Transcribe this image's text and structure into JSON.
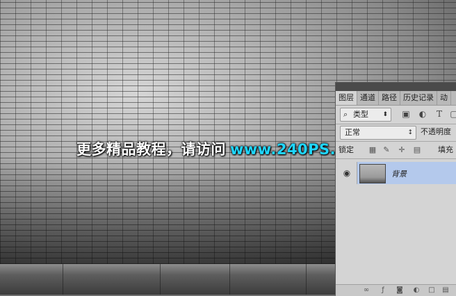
{
  "watermark": {
    "text_cn": "更多精品教程，请访问",
    "text_url": "www.240PS.com"
  },
  "colors": {
    "accent_url": "#1fd6ff",
    "selected_layer": "#b4c9ec"
  },
  "layers_panel": {
    "tabs": [
      {
        "label": "图层",
        "active": true
      },
      {
        "label": "通道",
        "active": false
      },
      {
        "label": "路径",
        "active": false
      },
      {
        "label": "历史记录",
        "active": false
      },
      {
        "label": "动",
        "active": false
      }
    ],
    "filter": {
      "kind_label": "类型",
      "icons": [
        "search-icon",
        "image-filter-icon",
        "adjustment-filter-icon",
        "type-filter-icon",
        "shape-filter-icon"
      ]
    },
    "blend_mode": "正常",
    "opacity_label": "不透明度",
    "lock_label": "锁定",
    "fill_label": "填充",
    "layers": [
      {
        "name": "背景",
        "visible": true,
        "selected": true
      }
    ]
  }
}
